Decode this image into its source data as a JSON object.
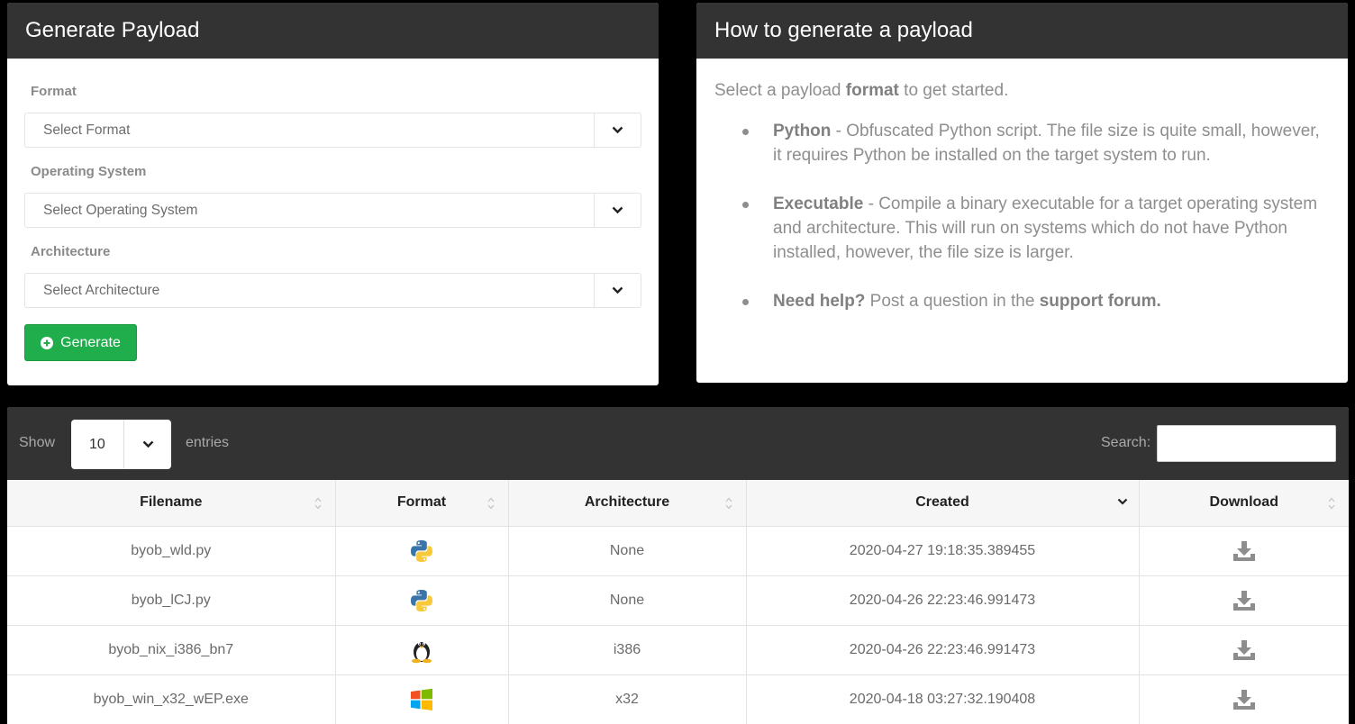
{
  "generate": {
    "title": "Generate Payload",
    "format_label": "Format",
    "format_value": "Select Format",
    "os_label": "Operating System",
    "os_value": "Select Operating System",
    "arch_label": "Architecture",
    "arch_value": "Select Architecture",
    "generate_button": "Generate"
  },
  "howto": {
    "title": "How to generate a payload",
    "intro_prefix": "Select a payload ",
    "intro_bold": "format",
    "intro_suffix": " to get started.",
    "items": [
      {
        "bold": "Python",
        "text": " - Obfuscated Python script. The file size is quite small, however, it requires Python be installed on the target system to run."
      },
      {
        "bold": "Executable",
        "text": " - Compile a binary executable for a target operating system and architecture. This will run on systems which do not have Python installed, however, the file size is larger."
      },
      {
        "bold": "Need help?",
        "text": " Post a question in the ",
        "link": "support forum."
      }
    ]
  },
  "table": {
    "show_label": "Show",
    "page_length": "10",
    "entries_label": "entries",
    "search_label": "Search:",
    "search_value": "",
    "columns": [
      "Filename",
      "Format",
      "Architecture",
      "Created",
      "Download"
    ],
    "rows": [
      {
        "filename": "byob_wld.py",
        "format_icon": "python-icon",
        "architecture": "None",
        "created": "2020-04-27 19:18:35.389455"
      },
      {
        "filename": "byob_lCJ.py",
        "format_icon": "python-icon",
        "architecture": "None",
        "created": "2020-04-26 22:23:46.991473"
      },
      {
        "filename": "byob_nix_i386_bn7",
        "format_icon": "linux-tux-icon",
        "architecture": "i386",
        "created": "2020-04-26 22:23:46.991473"
      },
      {
        "filename": "byob_win_x32_wEP.exe",
        "format_icon": "windows-icon",
        "architecture": "x32",
        "created": "2020-04-18 03:27:32.190408"
      }
    ]
  },
  "colors": {
    "header_bg": "#333333",
    "generate_green": "#1fae4b",
    "muted_text": "#8e8e8e"
  }
}
